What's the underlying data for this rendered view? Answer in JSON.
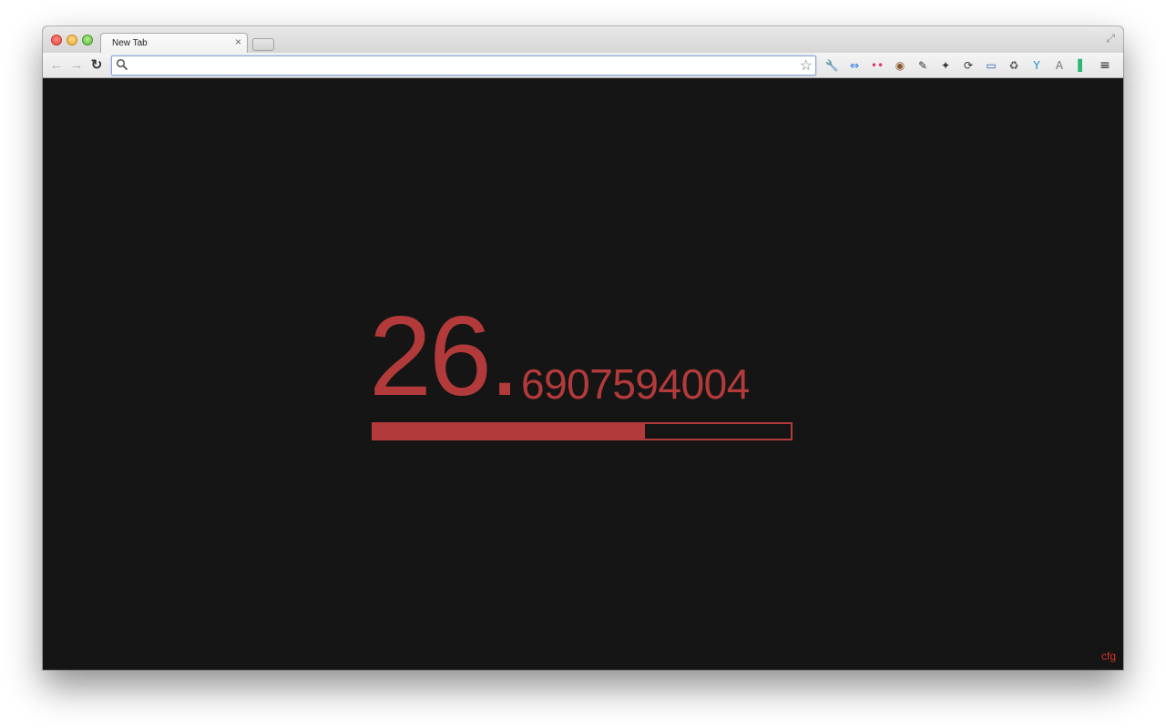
{
  "browser": {
    "tab_title": "New Tab",
    "tab_close": "×",
    "omnibox": {
      "value": "",
      "placeholder": ""
    },
    "nav": {
      "back": "←",
      "forward": "→",
      "reload": "↻"
    },
    "extensions": [
      {
        "name": "wrench-icon",
        "glyph": "🔧",
        "color": "#444"
      },
      {
        "name": "arrows-icon",
        "glyph": "⇔",
        "color": "#1a73e8"
      },
      {
        "name": "flickr-icon",
        "glyph": "••",
        "color": "#e0307a"
      },
      {
        "name": "instagram-icon",
        "glyph": "◉",
        "color": "#8a5a2b"
      },
      {
        "name": "evernote-icon",
        "glyph": "✎",
        "color": "#333"
      },
      {
        "name": "pin-icon",
        "glyph": "✦",
        "color": "#333"
      },
      {
        "name": "sync-icon",
        "glyph": "⟳",
        "color": "#333"
      },
      {
        "name": "screen-icon",
        "glyph": "▭",
        "color": "#2a5db0"
      },
      {
        "name": "recycle-icon",
        "glyph": "♻",
        "color": "#555"
      },
      {
        "name": "vimeo-icon",
        "glyph": "Y",
        "color": "#1a8ad4"
      },
      {
        "name": "angular-icon",
        "glyph": "A",
        "color": "#777"
      },
      {
        "name": "pushbullet-icon",
        "glyph": "▌",
        "color": "#2bb673"
      },
      {
        "name": "menu-icon",
        "glyph": "≡",
        "color": "#222"
      }
    ]
  },
  "clock": {
    "integer_part": "26.",
    "fraction_part": "6907594004",
    "progress": 0.65,
    "accent": "#b33a3a"
  },
  "footer": {
    "cfg": "cfg"
  }
}
